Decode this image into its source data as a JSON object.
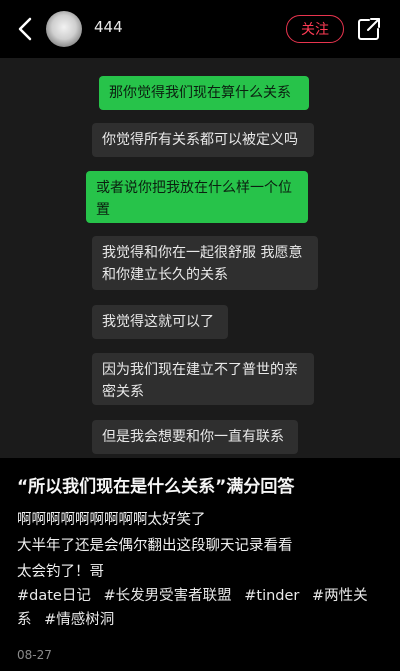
{
  "header": {
    "username": "444",
    "follow_label": "关注"
  },
  "chat": {
    "messages": [
      {
        "side": "me",
        "text": "那你觉得我们现在算什么关系"
      },
      {
        "side": "them",
        "text": "你觉得所有关系都可以被定义吗"
      },
      {
        "side": "me",
        "text": "或者说你把我放在什么样一个位置"
      },
      {
        "side": "them",
        "text": "我觉得和你在一起很舒服 我愿意和你建立长久的关系"
      },
      {
        "side": "them",
        "text": "我觉得这就可以了"
      },
      {
        "side": "them",
        "text": "因为我们现在建立不了普世的亲密关系"
      },
      {
        "side": "them",
        "text": "但是我会想要和你一直有联系"
      }
    ]
  },
  "post": {
    "title": "“所以我们现在是什么关系”满分回答",
    "lines": [
      "啊啊啊啊啊啊啊啊啊太好笑了",
      "大半年了还是会偶尔翻出这段聊天记录看看",
      "太会钓了！哥"
    ],
    "tags": [
      "#date日记",
      "#长发男受害者联盟",
      "#tinder",
      "#两性关系",
      "#情感树洞"
    ],
    "date": "08-27"
  },
  "colors": {
    "accent": "#ff3b55",
    "me_bubble": "#27c34a",
    "them_bubble": "#2f2f2f"
  }
}
